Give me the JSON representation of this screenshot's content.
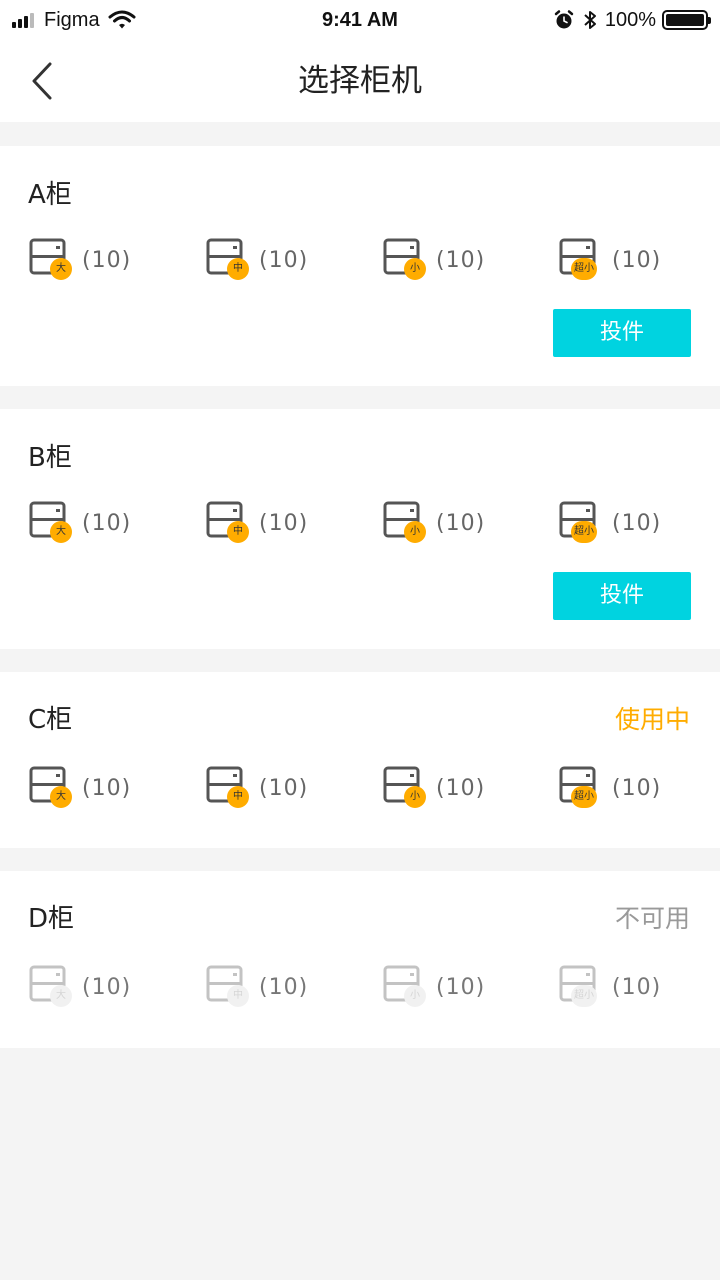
{
  "colors": {
    "accent": "#00d3e0",
    "badge": "#ffac00",
    "in_use": "#ffac00",
    "unavailable": "#999999",
    "disabled_badge": "#d8d8d8"
  },
  "status_bar": {
    "carrier": "Figma",
    "time": "9:41 AM",
    "battery": "100%",
    "battery_level": 1.0,
    "icons": [
      "signal-icon",
      "wifi-icon",
      "alarm-icon",
      "bluetooth-icon",
      "battery-icon"
    ]
  },
  "nav": {
    "title": "选择柜机",
    "back_icon": "chevron-left-icon"
  },
  "lockers": [
    {
      "name": "A柜",
      "status": "",
      "button": "投件",
      "slots": [
        {
          "size": "大",
          "count": "(10)"
        },
        {
          "size": "中",
          "count": "(10)"
        },
        {
          "size": "小",
          "count": "(10)"
        },
        {
          "size": "超小",
          "count": "(10)"
        }
      ]
    },
    {
      "name": "B柜",
      "status": "",
      "button": "投件",
      "slots": [
        {
          "size": "大",
          "count": "(10)"
        },
        {
          "size": "中",
          "count": "(10)"
        },
        {
          "size": "小",
          "count": "(10)"
        },
        {
          "size": "超小",
          "count": "(10)"
        }
      ]
    },
    {
      "name": "C柜",
      "status": "使用中",
      "button": "",
      "slots": [
        {
          "size": "大",
          "count": "(10)"
        },
        {
          "size": "中",
          "count": "(10)"
        },
        {
          "size": "小",
          "count": "(10)"
        },
        {
          "size": "超小",
          "count": "(10)"
        }
      ]
    },
    {
      "name": "D柜",
      "status": "不可用",
      "button": "",
      "slots": [
        {
          "size": "大",
          "count": "(10)"
        },
        {
          "size": "中",
          "count": "(10)"
        },
        {
          "size": "小",
          "count": "(10)"
        },
        {
          "size": "超小",
          "count": "(10)"
        }
      ]
    }
  ]
}
